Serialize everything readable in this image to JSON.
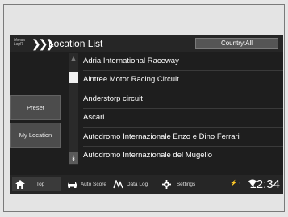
{
  "header": {
    "title": "Location List",
    "country_label": "Country:All",
    "logo_text": "Honda\nLogR"
  },
  "side": {
    "preset": "Preset",
    "my_location": "My Location"
  },
  "locations": [
    "Adria International Raceway",
    "Aintree Motor Racing Circuit",
    "Anderstorp circuit",
    "Ascari",
    "Autodromo Internazionale Enzo e Dino Ferrari",
    "Autodromo Internazionale del Mugello"
  ],
  "bottom_bar": {
    "top": "Top",
    "auto_score": "Auto Score",
    "data_log": "Data Log",
    "settings": "Settings",
    "clock": "12:34"
  },
  "icons": {
    "home": "home-icon",
    "car": "car-icon",
    "data_log": "data-log-icon",
    "settings": "gear-icon",
    "wifi": "wifi-icon"
  }
}
